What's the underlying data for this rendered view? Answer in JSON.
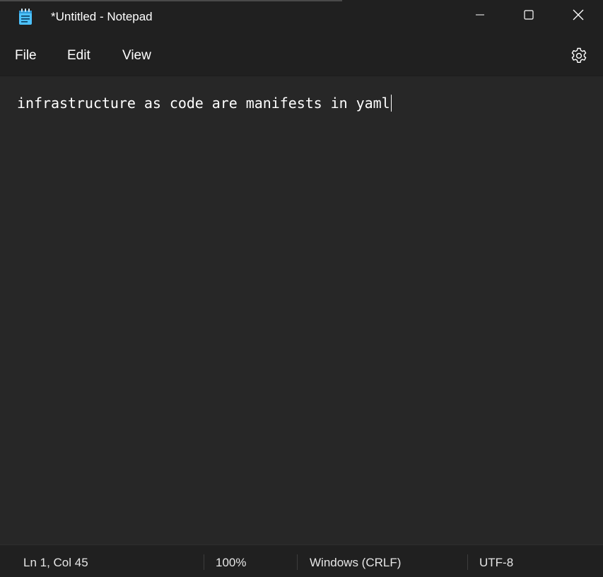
{
  "window": {
    "title": "*Untitled - Notepad",
    "icon": "notepad-icon",
    "controls": [
      "minimize-icon",
      "maximize-icon",
      "close-icon"
    ]
  },
  "menu": {
    "file": "File",
    "edit": "Edit",
    "view": "View",
    "settings_icon": "gear-icon"
  },
  "editor": {
    "content": "infrastructure as code are manifests in yaml"
  },
  "status": {
    "position": "Ln 1, Col 45",
    "zoom": "100%",
    "line_ending": "Windows (CRLF)",
    "encoding": "UTF-8"
  },
  "colors": {
    "chrome_bg": "#202020",
    "editor_bg": "#272727",
    "text": "#ffffff",
    "icon_accent": "#4cc2ff"
  }
}
